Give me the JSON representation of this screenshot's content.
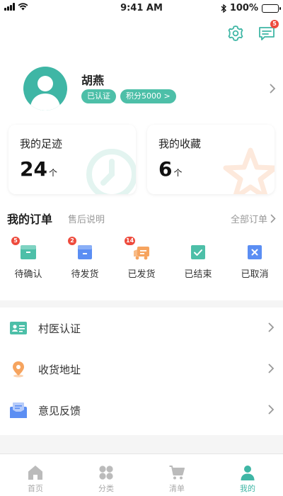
{
  "status": {
    "time": "9:41 AM",
    "battery": "100%"
  },
  "header": {
    "message_badge": "5"
  },
  "profile": {
    "name": "胡燕",
    "tag_verified": "已认证",
    "tag_points": "积分5000 >"
  },
  "cards": [
    {
      "title": "我的足迹",
      "value": "24",
      "unit": "个"
    },
    {
      "title": "我的收藏",
      "value": "6",
      "unit": "个"
    }
  ],
  "orders": {
    "title": "我的订单",
    "subtitle": "售后说明",
    "all_label": "全部订单",
    "items": [
      {
        "label": "待确认",
        "badge": "5",
        "icon": "pending-confirm-icon",
        "color": "#4dbfa8"
      },
      {
        "label": "待发货",
        "badge": "2",
        "icon": "pending-ship-icon",
        "color": "#5b8ef3"
      },
      {
        "label": "已发货",
        "badge": "14",
        "icon": "truck-icon",
        "color": "#f6a45f"
      },
      {
        "label": "已结束",
        "badge": "",
        "icon": "finished-icon",
        "color": "#4dbfa8"
      },
      {
        "label": "已取消",
        "badge": "",
        "icon": "cancel-icon",
        "color": "#5b8ef3"
      }
    ]
  },
  "menu": [
    {
      "label": "村医认证",
      "icon": "id-card-icon"
    },
    {
      "label": "收货地址",
      "icon": "location-pin-icon"
    },
    {
      "label": "意见反馈",
      "icon": "feedback-envelope-icon"
    }
  ],
  "tabs": [
    {
      "label": "首页",
      "icon": "home-icon",
      "active": false
    },
    {
      "label": "分类",
      "icon": "category-icon",
      "active": false
    },
    {
      "label": "清单",
      "icon": "cart-icon",
      "active": false
    },
    {
      "label": "我的",
      "icon": "user-icon",
      "active": true
    }
  ],
  "colors": {
    "accent": "#3fb6a5",
    "badge": "#ee4b3d",
    "blue": "#5b8ef3",
    "orange": "#f6a45f"
  }
}
